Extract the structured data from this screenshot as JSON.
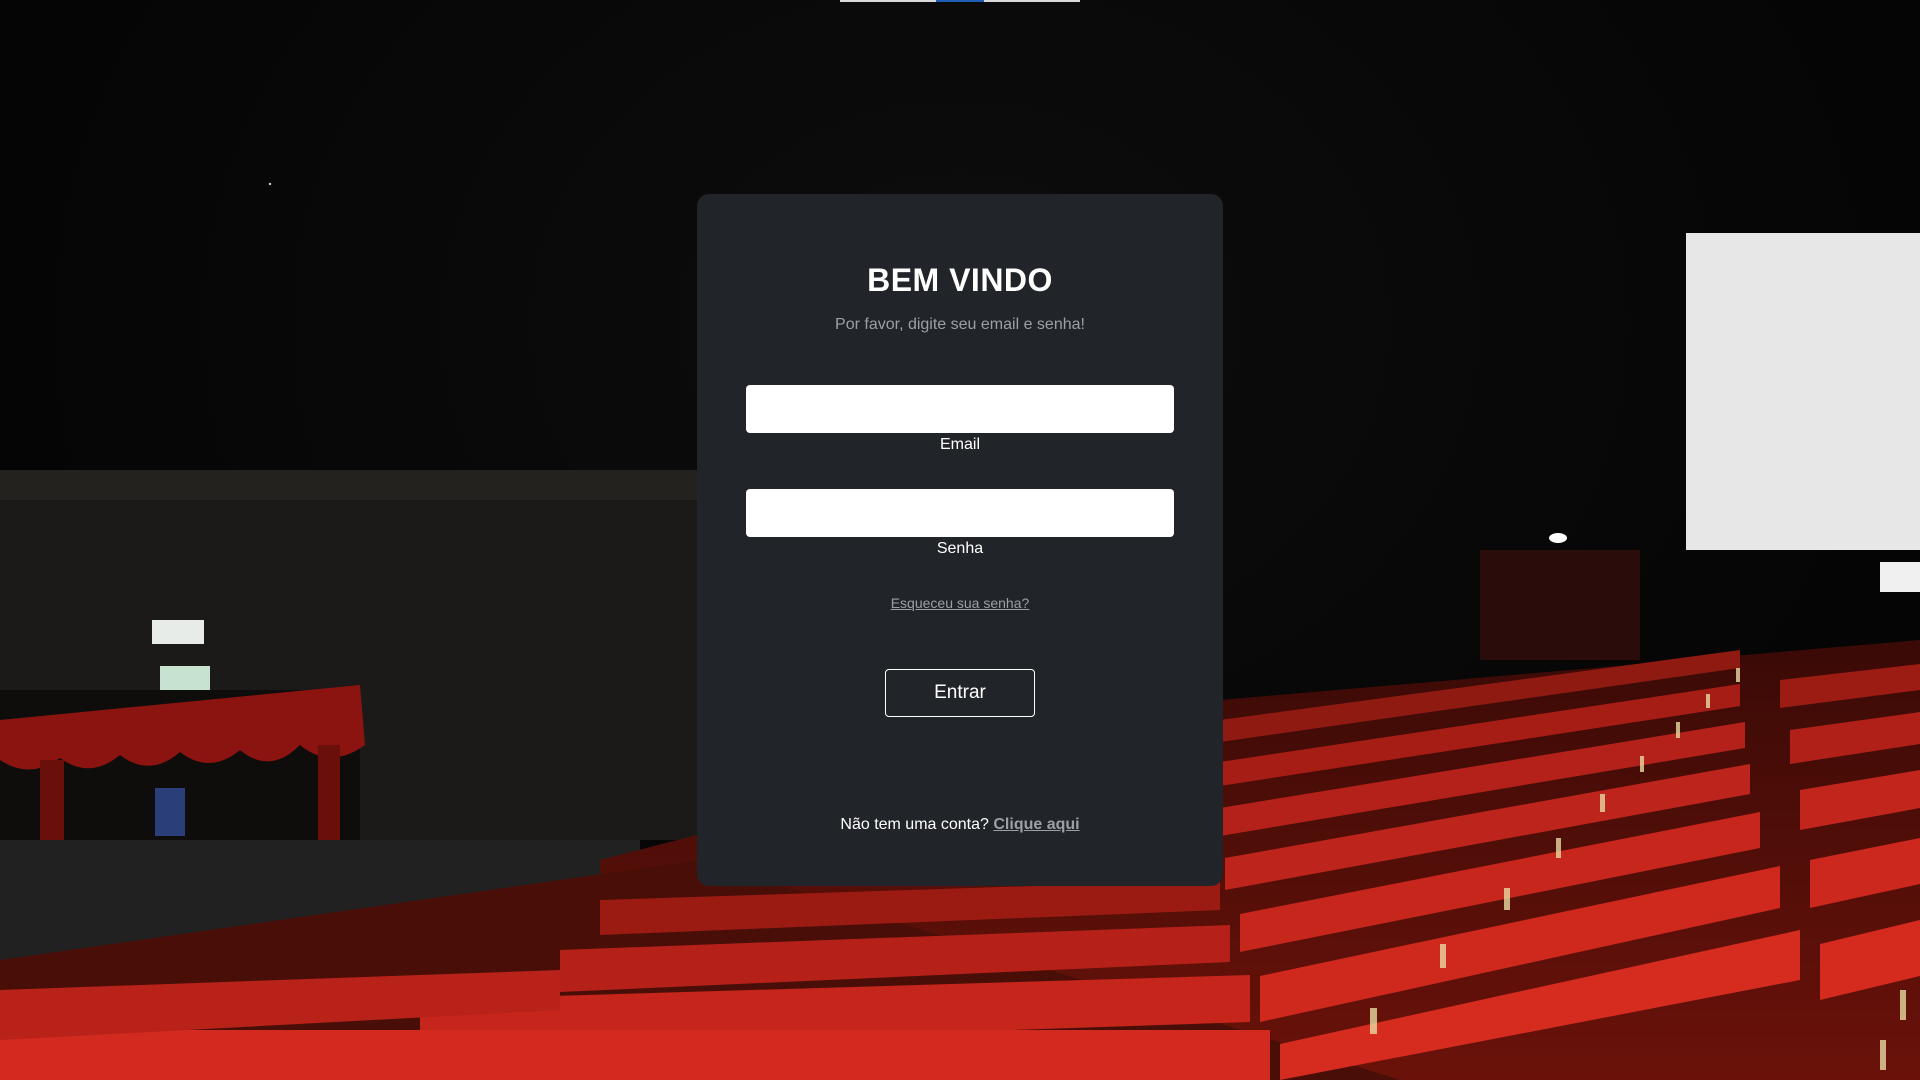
{
  "login": {
    "title": "BEM VINDO",
    "subtitle": "Por favor, digite seu email e senha!",
    "email_label": "Email",
    "email_value": "",
    "senha_label": "Senha",
    "senha_value": "",
    "forgot_link": "Esqueceu sua senha?",
    "submit_label": "Entrar",
    "signup_prompt": "Não tem uma conta?",
    "signup_link": "Clique aqui"
  },
  "colors": {
    "card_bg": "#212529",
    "muted_text": "#9aa0a6",
    "seat_red": "#b3160f",
    "background": "#050505"
  },
  "background": {
    "icon": "cinema-auditorium-photo"
  }
}
